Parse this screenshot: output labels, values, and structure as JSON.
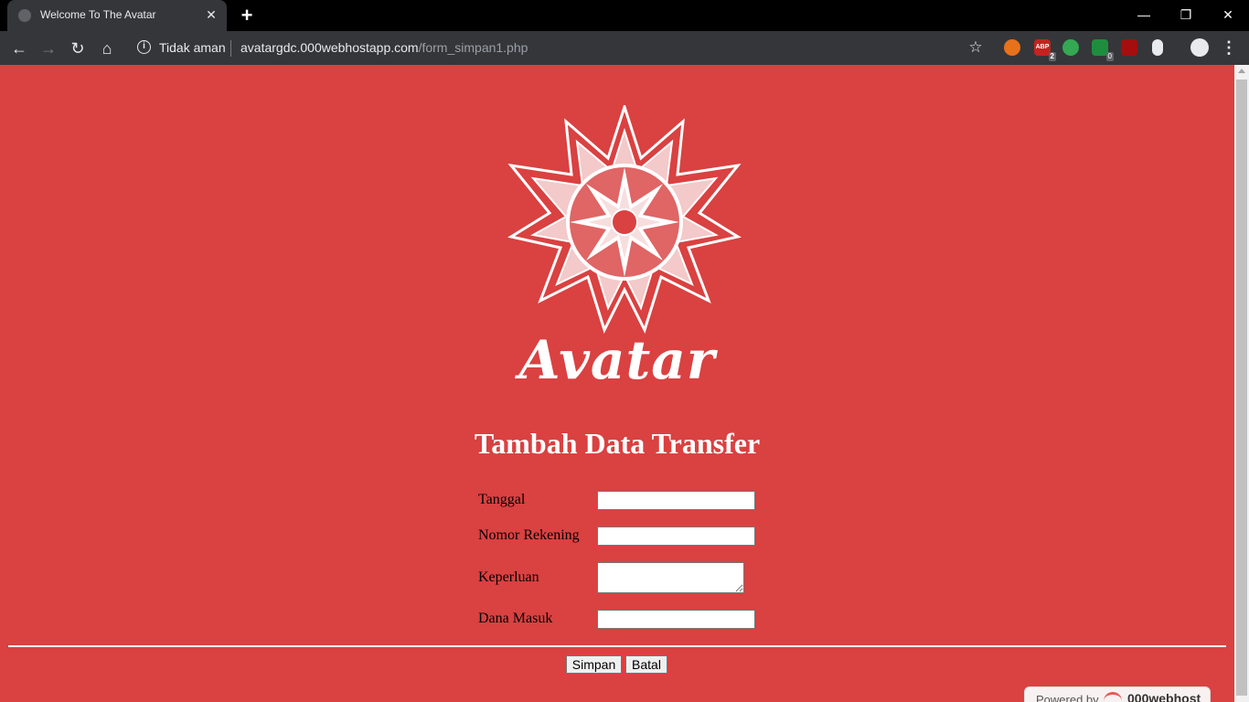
{
  "browser": {
    "tab": {
      "title": "Welcome To The Avatar",
      "close_glyph": "✕"
    },
    "new_tab_glyph": "+",
    "window": {
      "minimize_glyph": "—",
      "maximize_glyph": "❐",
      "close_glyph": "✕"
    },
    "toolbar": {
      "back_glyph": "←",
      "forward_glyph": "→",
      "reload_glyph": "↻",
      "home_glyph": "⌂",
      "info_glyph": "i",
      "security_label": "Tidak aman",
      "url_host": "avatargdc.000webhostapp.com",
      "url_path": "/form_simpan1.php",
      "star_glyph": "☆",
      "menu_glyph": "⋮",
      "extensions": [
        {
          "name": "ext-1-icon",
          "badge": ""
        },
        {
          "name": "adblock-icon",
          "label": "ABP",
          "badge": "2"
        },
        {
          "name": "ext-3-icon",
          "badge": ""
        },
        {
          "name": "ext-4-icon",
          "badge": "0"
        },
        {
          "name": "ext-5-icon",
          "badge": ""
        },
        {
          "name": "ext-6-icon",
          "badge": ""
        }
      ]
    }
  },
  "page": {
    "background_color": "#da4141",
    "logo": {
      "text": "Avatar"
    },
    "form": {
      "title": "Tambah Data Transfer",
      "fields": {
        "tanggal": {
          "label": "Tanggal",
          "value": ""
        },
        "rekening": {
          "label": "Nomor Rekening",
          "value": ""
        },
        "keperluan": {
          "label": "Keperluan",
          "value": ""
        },
        "dana": {
          "label": "Dana Masuk",
          "value": ""
        }
      },
      "buttons": {
        "submit": "Simpan",
        "cancel": "Batal"
      }
    },
    "footer_badge": {
      "powered_by": "Powered by",
      "brand": "000webhost"
    }
  }
}
